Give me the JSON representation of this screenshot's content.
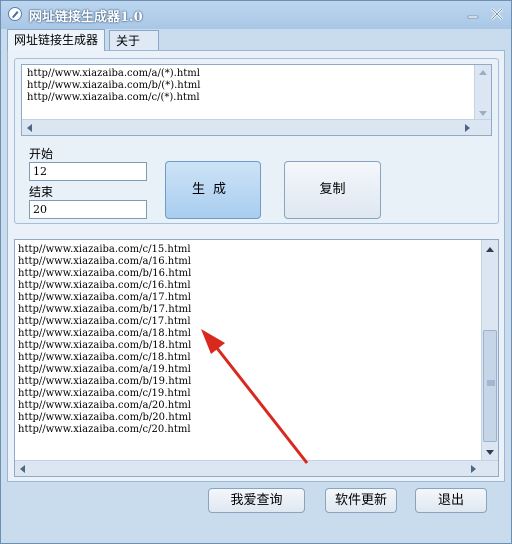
{
  "window": {
    "title": "网址链接生成器1.0"
  },
  "tabs": [
    {
      "label": "网址链接生成器"
    },
    {
      "label": "关于"
    }
  ],
  "template_lines": [
    "http//www.xiazaiba.com/a/(*).html",
    "http//www.xiazaiba.com/b/(*).html",
    "http//www.xiazaiba.com/c/(*).html"
  ],
  "form": {
    "start_label": "开始",
    "start_value": "12",
    "end_label": "结束",
    "end_value": "20"
  },
  "buttons": {
    "generate": "生成",
    "copy": "复制",
    "query": "我爱查询",
    "update": "软件更新",
    "exit": "退出"
  },
  "result_lines": [
    "http//www.xiazaiba.com/c/15.html",
    "http//www.xiazaiba.com/a/16.html",
    "http//www.xiazaiba.com/b/16.html",
    "http//www.xiazaiba.com/c/16.html",
    "http//www.xiazaiba.com/a/17.html",
    "http//www.xiazaiba.com/b/17.html",
    "http//www.xiazaiba.com/c/17.html",
    "http//www.xiazaiba.com/a/18.html",
    "http//www.xiazaiba.com/b/18.html",
    "http//www.xiazaiba.com/c/18.html",
    "http//www.xiazaiba.com/a/19.html",
    "http//www.xiazaiba.com/b/19.html",
    "http//www.xiazaiba.com/c/19.html",
    "http//www.xiazaiba.com/a/20.html",
    "http//www.xiazaiba.com/b/20.html",
    "http//www.xiazaiba.com/c/20.html"
  ],
  "colors": {
    "annotation_arrow": "#d9281e",
    "accent": "#a9cdef"
  },
  "icons": {
    "app": "pen-icon",
    "minimize": "minimize-icon",
    "close": "close-icon"
  }
}
